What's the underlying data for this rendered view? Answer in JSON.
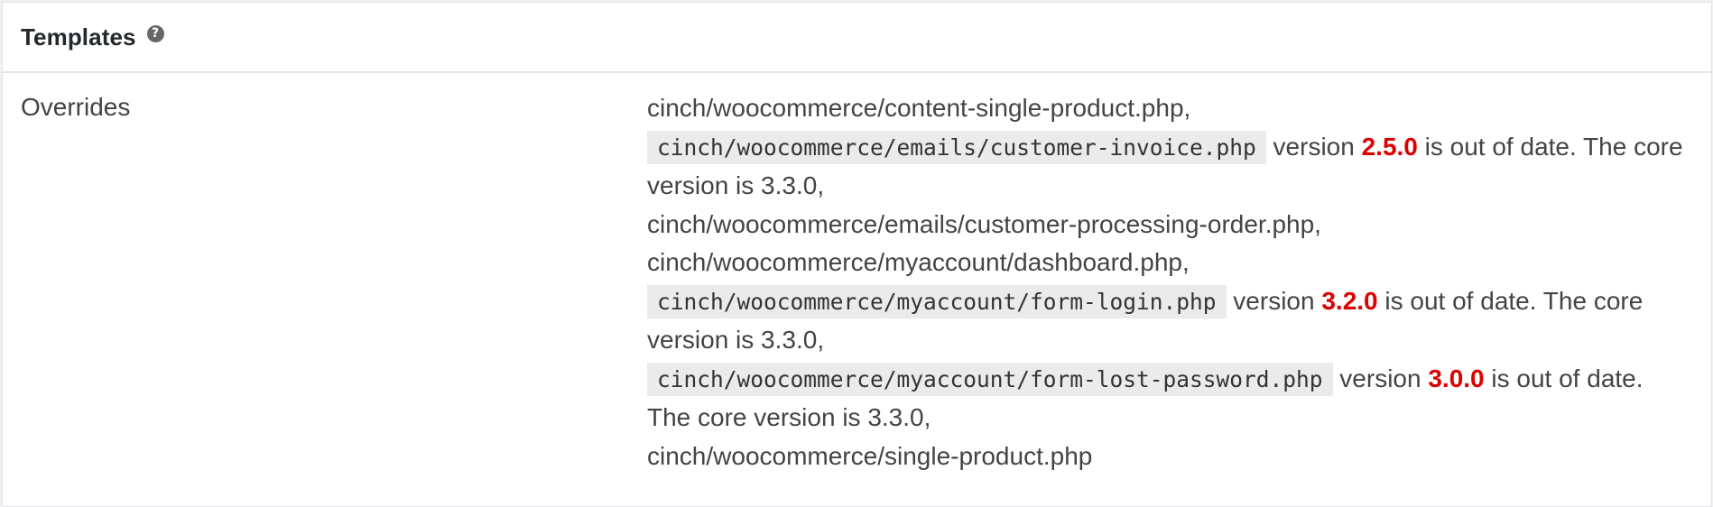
{
  "section": {
    "title": "Templates",
    "help_icon": "?"
  },
  "row": {
    "label": "Overrides"
  },
  "overrides": {
    "item1": "cinch/woocommerce/content-single-product.php,",
    "item2_file": "cinch/woocommerce/emails/customer-invoice.php",
    "item2_prefix": "version",
    "item2_version": "2.5.0",
    "item2_suffix": "is out of date. The core version is 3.3.0,",
    "item3": "cinch/woocommerce/emails/customer-processing-order.php,",
    "item4": "cinch/woocommerce/myaccount/dashboard.php,",
    "item5_file": "cinch/woocommerce/myaccount/form-login.php",
    "item5_prefix": "version",
    "item5_version": "3.2.0",
    "item5_suffix": "is out of date. The core version is 3.3.0,",
    "item6_file": "cinch/woocommerce/myaccount/form-lost-password.php",
    "item6_prefix": "version",
    "item6_version": "3.0.0",
    "item6_suffix": "is out of date. The core version is 3.3.0,",
    "item7": "cinch/woocommerce/single-product.php"
  },
  "colors": {
    "outdated_version": "#e00000",
    "code_background": "#ebebeb"
  }
}
